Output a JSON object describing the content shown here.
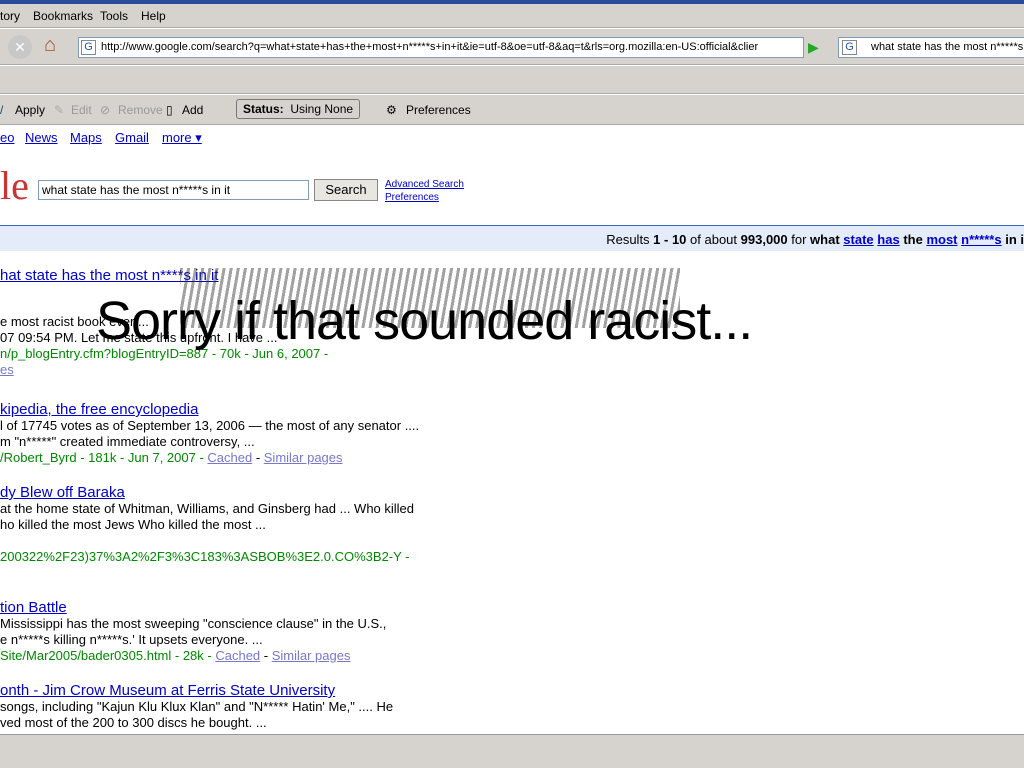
{
  "menu": [
    "tory",
    "Bookmarks",
    "Tools",
    "Help"
  ],
  "url": "http://www.google.com/search?q=what+state+has+the+most+n*****s+in+it&ie=utf-8&oe=utf-8&aq=t&rls=org.mozilla:en-US:official&clier",
  "search_box": "what state has the most n*****s",
  "toolbar": {
    "apply": "Apply",
    "edit": "Edit",
    "remove": "Remove",
    "add": "Add",
    "status_label": "Status:",
    "status_value": "Using None",
    "preferences": "Preferences"
  },
  "google_links": [
    "eo",
    "News",
    "Maps",
    "Gmail",
    "more ▾"
  ],
  "logo": "le",
  "query": "what state has the most n*****s in it",
  "search_button": "Search",
  "advanced_search": "Advanced Search",
  "preferences_link": "Preferences",
  "results_bar": {
    "prefix": "Results ",
    "range": "1 - 10",
    "of": " of about ",
    "total": "993,000",
    "for": " for ",
    "q1": "what",
    "q2": "state",
    "q3": "has",
    "q4": "the",
    "q5": "most",
    "q6": "n*****s",
    "q7": "in i"
  },
  "overlay_text": "Sorry if that sounded  racist...",
  "results": [
    {
      "title": "hat state has the most n****s in it",
      "s1": "e most racist book ever ...",
      "s2": "07 09:54 PM. Let me state this upfront. I have ...",
      "url": "n/p_blogEntry.cfm?blogEntryID=887 - 70k - Jun 6, 2007 -",
      "extra": "es"
    },
    {
      "title": "kipedia, the free encyclopedia",
      "s1": "l of 17745 votes as of September 13, 2006 — the most of any senator ....",
      "s2": "m \"n*****\" created immediate controversy, ...",
      "url": "/Robert_Byrd - 181k - Jun 7, 2007 - ",
      "cached": "Cached",
      "similar": "Similar pages"
    },
    {
      "title": "dy Blew off Baraka",
      "s1": "at the home state of Whitman, Williams, and Ginsberg had ... Who killed",
      "s2": "ho killed the most Jews Who killed the most ...",
      "url": "200322%2F23)37%3A2%2F3%3C183%3ASBOB%3E2.0.CO%3B2-Y -"
    },
    {
      "title": "tion Battle",
      "s1": "Mississippi has the most sweeping \"conscience clause\" in the U.S.,",
      "s2": "e n*****s killing n*****s.' It upsets everyone. ...",
      "url": "Site/Mar2005/bader0305.html - 28k - ",
      "cached": "Cached",
      "similar": "Similar pages"
    },
    {
      "title": "onth - Jim Crow Museum at Ferris State University",
      "s1": "songs, including \"Kajun Klu Klux Klan\" and \"N***** Hatin' Me,\" .... He",
      "s2": "ved most of the 200 to 300 discs he bought. ..."
    }
  ]
}
